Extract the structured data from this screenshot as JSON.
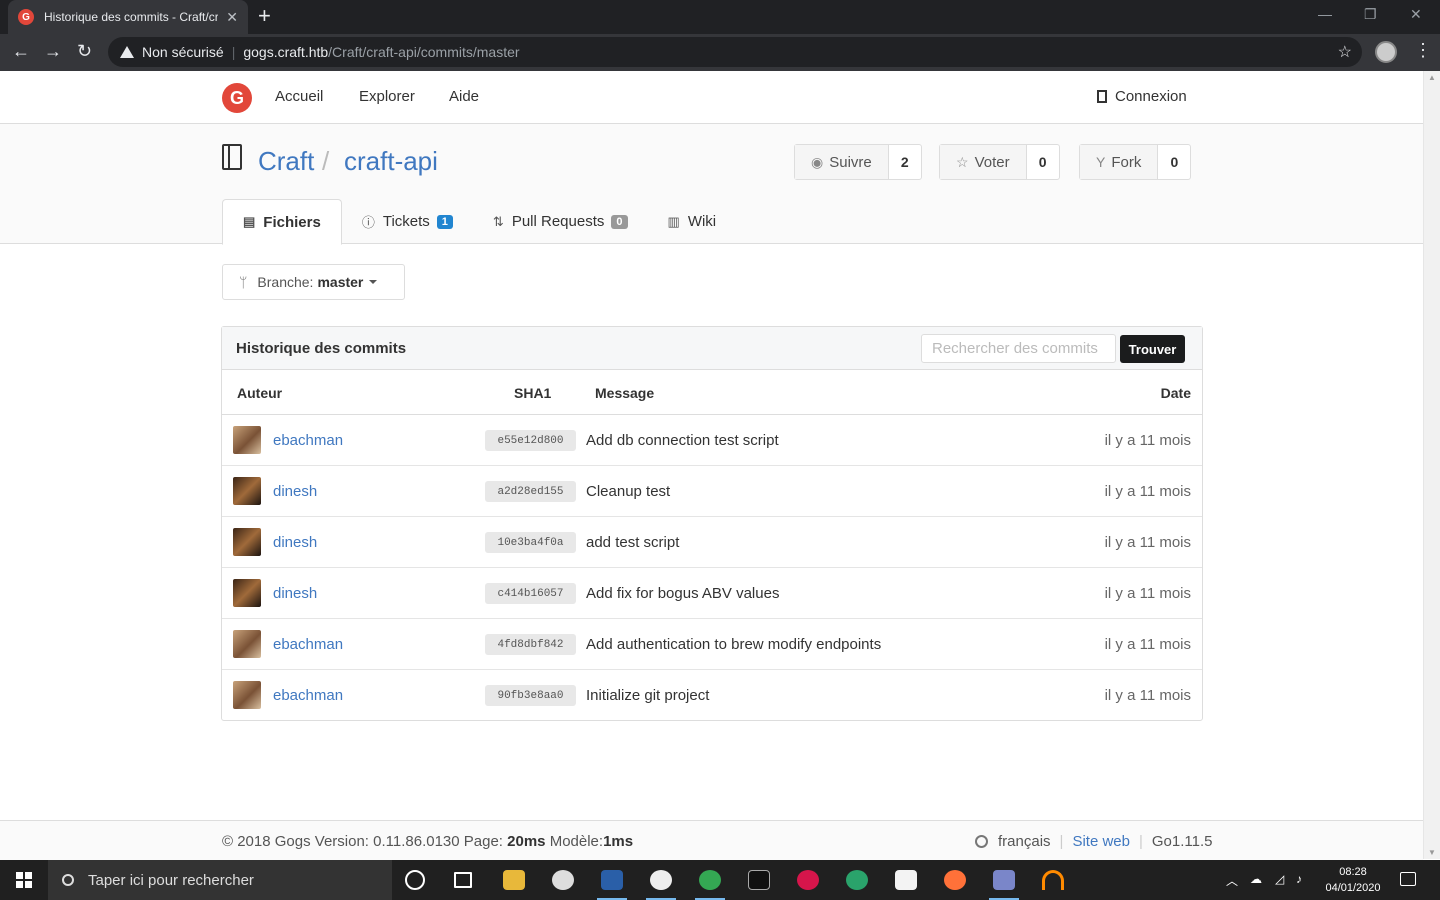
{
  "browser": {
    "tab_title": "Historique des commits - Craft/craft-api",
    "new_tab": "+",
    "security_label": "Non sécurisé",
    "url_host": "gogs.craft.htb",
    "url_path": "/Craft/craft-api/commits/master"
  },
  "nav": {
    "home": "Accueil",
    "explore": "Explorer",
    "help": "Aide",
    "login": "Connexion"
  },
  "repo": {
    "owner": "Craft",
    "separator": "/",
    "name": "craft-api",
    "watch_label": "Suivre",
    "watch_count": "2",
    "star_label": "Voter",
    "star_count": "0",
    "fork_label": "Fork",
    "fork_count": "0"
  },
  "tabs": [
    {
      "label": "Fichiers",
      "badge": ""
    },
    {
      "label": "Tickets",
      "badge": "1"
    },
    {
      "label": "Pull Requests",
      "badge": "0"
    },
    {
      "label": "Wiki",
      "badge": ""
    }
  ],
  "branch": {
    "prefix": "Branche:",
    "name": "master"
  },
  "commits": {
    "title": "Historique des commits",
    "search_placeholder": "Rechercher des commits",
    "search_button": "Trouver",
    "columns": {
      "author": "Auteur",
      "sha": "SHA1",
      "message": "Message",
      "date": "Date"
    },
    "rows": [
      {
        "author": "ebachman",
        "sha": "e55e12d800",
        "message": "Add db connection test script",
        "date": "il y a 11 mois"
      },
      {
        "author": "dinesh",
        "sha": "a2d28ed155",
        "message": "Cleanup test",
        "date": "il y a 11 mois"
      },
      {
        "author": "dinesh",
        "sha": "10e3ba4f0a",
        "message": "add test script",
        "date": "il y a 11 mois"
      },
      {
        "author": "dinesh",
        "sha": "c414b16057",
        "message": "Add fix for bogus ABV values",
        "date": "il y a 11 mois"
      },
      {
        "author": "ebachman",
        "sha": "4fd8dbf842",
        "message": "Add authentication to brew modify endpoints",
        "date": "il y a 11 mois"
      },
      {
        "author": "ebachman",
        "sha": "90fb3e8aa0",
        "message": "Initialize git project",
        "date": "il y a 11 mois"
      }
    ]
  },
  "footer": {
    "prefix": "© 2018 Gogs Version: 0.11.86.0130 Page:",
    "page_time": "20ms",
    "model_label": "Modèle:",
    "model_time": "1ms",
    "language": "français",
    "website": "Site web",
    "go_version": "Go1.11.5"
  },
  "taskbar": {
    "search_placeholder": "Taper ici pour rechercher",
    "time": "08:28",
    "date": "04/01/2020"
  },
  "colors": {
    "accent_link": "#4078c0",
    "gogs_logo": "#e2473a",
    "badge_blue": "#2185d0",
    "badge_grey": "#999999",
    "find_button": "#1b1c1d"
  }
}
